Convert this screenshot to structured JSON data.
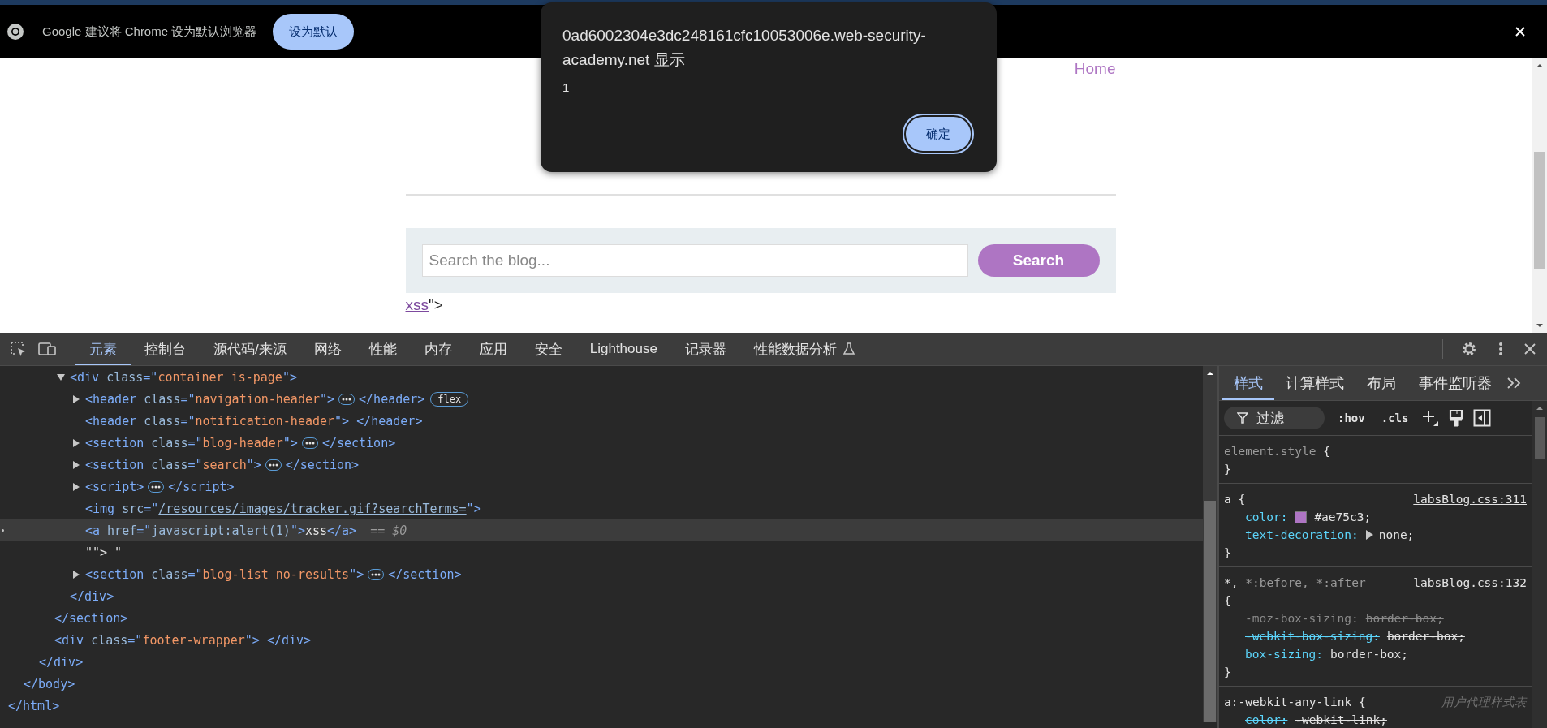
{
  "infobar": {
    "message": "Google 建议将 Chrome 设为默认浏览器",
    "button": "设为默认"
  },
  "page": {
    "nav_link": "Home",
    "search": {
      "placeholder": "Search the blog...",
      "button": "Search"
    },
    "result_link": "xss",
    "result_suffix": "\">"
  },
  "dialog": {
    "title": "0ad6002304e3dc248161cfc10053006e.web-security-academy.net 显示",
    "message": "1",
    "button": "确定"
  },
  "devtools": {
    "tabs": [
      {
        "label": "元素",
        "selected": true,
        "experimental": false
      },
      {
        "label": "控制台",
        "selected": false,
        "experimental": false
      },
      {
        "label": "源代码/来源",
        "selected": false,
        "experimental": false
      },
      {
        "label": "网络",
        "selected": false,
        "experimental": false
      },
      {
        "label": "性能",
        "selected": false,
        "experimental": false
      },
      {
        "label": "内存",
        "selected": false,
        "experimental": false
      },
      {
        "label": "应用",
        "selected": false,
        "experimental": false
      },
      {
        "label": "安全",
        "selected": false,
        "experimental": false
      },
      {
        "label": "Lighthouse",
        "selected": false,
        "experimental": false
      },
      {
        "label": "记录器",
        "selected": false,
        "experimental": false
      },
      {
        "label": "性能数据分析",
        "selected": false,
        "experimental": true
      }
    ],
    "elements": [
      {
        "close": "</html>",
        "children": [
          {
            "close": "</body>",
            "children": [
              {
                "close": "</div>",
                "children": [
                  {
                    "close": "</section>",
                    "children": [
                      {
                        "selected": false,
                        "expanded": true,
                        "close": "</div>",
                        "line": [
                          {
                            "kind": "code",
                            "tokens": [
                              {
                                "kind": "tag",
                                "text": "<div"
                              },
                              {
                                "kind": "attr",
                                "text": " class"
                              },
                              {
                                "kind": "tag",
                                "text": "=\""
                              },
                              {
                                "kind": "value",
                                "text": "container is-page"
                              },
                              {
                                "kind": "tag",
                                "text": "\">"
                              }
                            ]
                          }
                        ],
                        "children": [
                          {
                            "selected": false,
                            "expanded": false,
                            "line": [
                              {
                                "kind": "code",
                                "tokens": [
                                  {
                                    "kind": "tag",
                                    "text": "<header"
                                  },
                                  {
                                    "kind": "attr",
                                    "text": " class"
                                  },
                                  {
                                    "kind": "tag",
                                    "text": "=\""
                                  },
                                  {
                                    "kind": "value",
                                    "text": "navigation-header"
                                  },
                                  {
                                    "kind": "tag",
                                    "text": "\">"
                                  }
                                ]
                              },
                              {
                                "kind": "ellipsis"
                              },
                              {
                                "kind": "code",
                                "tokens": [
                                  {
                                    "kind": "tag",
                                    "text": "</header>"
                                  }
                                ]
                              },
                              {
                                "kind": "badge",
                                "text": "flex"
                              }
                            ]
                          },
                          {
                            "selected": false,
                            "line": [
                              {
                                "kind": "code",
                                "tokens": [
                                  {
                                    "kind": "tag",
                                    "text": "<header"
                                  },
                                  {
                                    "kind": "attr",
                                    "text": " class"
                                  },
                                  {
                                    "kind": "tag",
                                    "text": "=\""
                                  },
                                  {
                                    "kind": "value",
                                    "text": "notification-header"
                                  },
                                  {
                                    "kind": "tag",
                                    "text": "\"> </header>"
                                  }
                                ]
                              }
                            ]
                          },
                          {
                            "selected": false,
                            "expanded": false,
                            "line": [
                              {
                                "kind": "code",
                                "tokens": [
                                  {
                                    "kind": "tag",
                                    "text": "<section"
                                  },
                                  {
                                    "kind": "attr",
                                    "text": " class"
                                  },
                                  {
                                    "kind": "tag",
                                    "text": "=\""
                                  },
                                  {
                                    "kind": "value",
                                    "text": "blog-header"
                                  },
                                  {
                                    "kind": "tag",
                                    "text": "\">"
                                  }
                                ]
                              },
                              {
                                "kind": "ellipsis"
                              },
                              {
                                "kind": "code",
                                "tokens": [
                                  {
                                    "kind": "tag",
                                    "text": "</section>"
                                  }
                                ]
                              }
                            ]
                          },
                          {
                            "selected": false,
                            "expanded": false,
                            "line": [
                              {
                                "kind": "code",
                                "tokens": [
                                  {
                                    "kind": "tag",
                                    "text": "<section"
                                  },
                                  {
                                    "kind": "attr",
                                    "text": " class"
                                  },
                                  {
                                    "kind": "tag",
                                    "text": "=\""
                                  },
                                  {
                                    "kind": "value",
                                    "text": "search"
                                  },
                                  {
                                    "kind": "tag",
                                    "text": "\">"
                                  }
                                ]
                              },
                              {
                                "kind": "ellipsis"
                              },
                              {
                                "kind": "code",
                                "tokens": [
                                  {
                                    "kind": "tag",
                                    "text": "</section>"
                                  }
                                ]
                              }
                            ]
                          },
                          {
                            "selected": false,
                            "expanded": false,
                            "line": [
                              {
                                "kind": "code",
                                "tokens": [
                                  {
                                    "kind": "tag",
                                    "text": "<script>"
                                  }
                                ]
                              },
                              {
                                "kind": "ellipsis"
                              },
                              {
                                "kind": "code",
                                "tokens": [
                                  {
                                    "kind": "tag",
                                    "text": "</script>"
                                  }
                                ]
                              }
                            ]
                          },
                          {
                            "selected": false,
                            "line": [
                              {
                                "kind": "code",
                                "tokens": [
                                  {
                                    "kind": "tag",
                                    "text": "<img"
                                  },
                                  {
                                    "kind": "attr",
                                    "text": " src"
                                  },
                                  {
                                    "kind": "tag",
                                    "text": "=\""
                                  },
                                  {
                                    "kind": "link",
                                    "text": "/resources/images/tracker.gif?searchTerms="
                                  },
                                  {
                                    "kind": "tag",
                                    "text": "\">"
                                  }
                                ]
                              }
                            ]
                          },
                          {
                            "selected": true,
                            "line": [
                              {
                                "kind": "code",
                                "tokens": [
                                  {
                                    "kind": "tag",
                                    "text": "<a"
                                  },
                                  {
                                    "kind": "attr",
                                    "text": " href"
                                  },
                                  {
                                    "kind": "tag",
                                    "text": "=\""
                                  },
                                  {
                                    "kind": "link",
                                    "text": "javascript:alert(1)"
                                  },
                                  {
                                    "kind": "tag",
                                    "text": "\">"
                                  },
                                  {
                                    "kind": "text",
                                    "text": "xss"
                                  },
                                  {
                                    "kind": "tag",
                                    "text": "</a>"
                                  }
                                ]
                              },
                              {
                                "kind": "ref",
                                "text": "== $0"
                              }
                            ]
                          },
                          {
                            "selected": false,
                            "line": [
                              {
                                "kind": "code",
                                "tokens": [
                                  {
                                    "kind": "text",
                                    "text": "\"\"> \""
                                  }
                                ]
                              }
                            ]
                          },
                          {
                            "selected": false,
                            "expanded": false,
                            "line": [
                              {
                                "kind": "code",
                                "tokens": [
                                  {
                                    "kind": "tag",
                                    "text": "<section"
                                  },
                                  {
                                    "kind": "attr",
                                    "text": " class"
                                  },
                                  {
                                    "kind": "tag",
                                    "text": "=\""
                                  },
                                  {
                                    "kind": "value",
                                    "text": "blog-list no-results"
                                  },
                                  {
                                    "kind": "tag",
                                    "text": "\">"
                                  }
                                ]
                              },
                              {
                                "kind": "ellipsis"
                              },
                              {
                                "kind": "code",
                                "tokens": [
                                  {
                                    "kind": "tag",
                                    "text": "</section>"
                                  }
                                ]
                              }
                            ]
                          }
                        ]
                      }
                    ]
                  },
                  {
                    "selected": false,
                    "line": [
                      {
                        "kind": "code",
                        "tokens": [
                          {
                            "kind": "tag",
                            "text": "<div"
                          },
                          {
                            "kind": "attr",
                            "text": " class"
                          },
                          {
                            "kind": "tag",
                            "text": "=\""
                          },
                          {
                            "kind": "value",
                            "text": "footer-wrapper"
                          },
                          {
                            "kind": "tag",
                            "text": "\"> </div>"
                          }
                        ]
                      }
                    ]
                  }
                ]
              }
            ]
          }
        ]
      }
    ],
    "styles": {
      "tabs": [
        {
          "label": "样式",
          "selected": true
        },
        {
          "label": "计算样式",
          "selected": false
        },
        {
          "label": "布局",
          "selected": false
        },
        {
          "label": "事件监听器",
          "selected": false
        }
      ],
      "filter": {
        "placeholder": "过滤"
      },
      "toggles": [
        ":hov",
        ".cls"
      ],
      "rules": [
        {
          "selector": [
            {
              "text": "element.style",
              "dim": true
            }
          ],
          "open": "{",
          "brace_wrapped": false,
          "close": "}"
        },
        {
          "selector": [
            {
              "text": "a",
              "dim": false
            }
          ],
          "open": "{",
          "brace_wrapped": false,
          "source": "labsBlog.css:311",
          "props": [
            {
              "name": "color:",
              "value": "#ae75c3;",
              "kind": "active",
              "expandable": false,
              "color": "#ae75c3"
            },
            {
              "name": "text-decoration:",
              "value": "none;",
              "kind": "active",
              "expandable": true
            }
          ],
          "close": "}"
        },
        {
          "selector": [
            {
              "text": "*,",
              "dim": false
            },
            {
              "text": " *:before,",
              "dim": true
            },
            {
              "text": " *:after",
              "dim": true
            }
          ],
          "open": "{",
          "brace_wrapped": true,
          "source": "labsBlog.css:132",
          "props": [
            {
              "name": "-moz-box-sizing:",
              "value": "border-box;",
              "kind": "invalid",
              "expandable": false
            },
            {
              "name": "-webkit-box-sizing:",
              "value": "border-box;",
              "kind": "overridden",
              "expandable": false
            },
            {
              "name": "box-sizing:",
              "value": "border-box;",
              "kind": "active",
              "expandable": false
            }
          ],
          "close": "}"
        },
        {
          "selector": [
            {
              "text": "a:-webkit-any-link",
              "dim": false
            }
          ],
          "open": "{",
          "brace_wrapped": false,
          "origin": "用户代理样式表",
          "props": [
            {
              "name": "color:",
              "value": "-webkit-link;",
              "kind": "overridden",
              "expandable": false
            }
          ]
        }
      ]
    }
  }
}
